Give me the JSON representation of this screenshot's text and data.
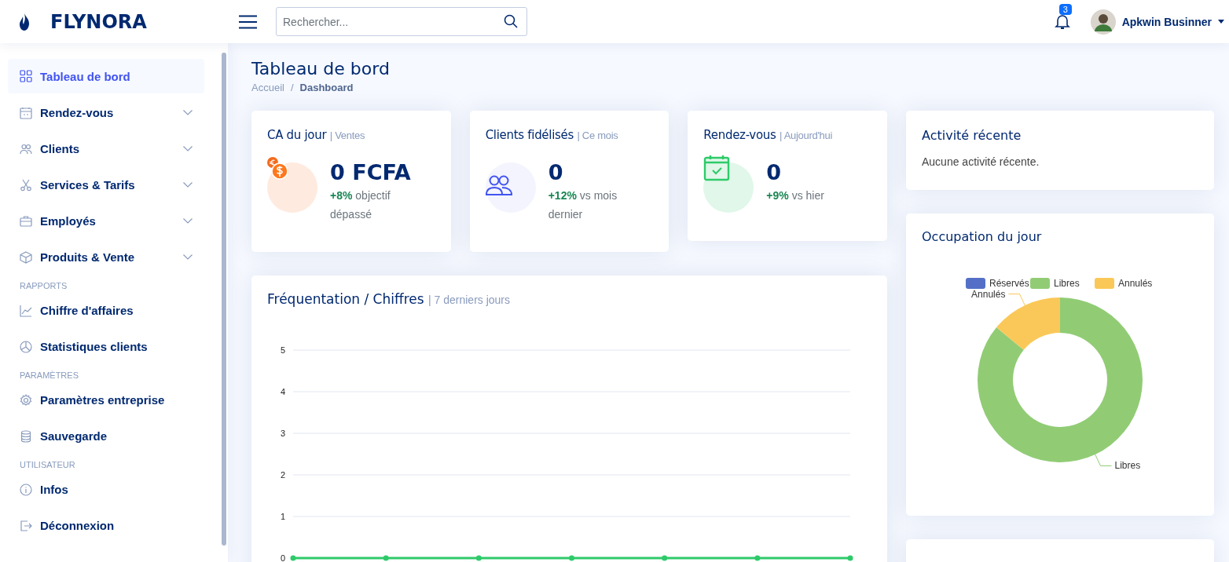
{
  "brand": {
    "name": "FLYNORA"
  },
  "search": {
    "placeholder": "Rechercher..."
  },
  "notifications": {
    "count": "3"
  },
  "user": {
    "name": "Apkwin Businner"
  },
  "sidebar": {
    "sections": [
      {
        "items": [
          {
            "label": "Tableau de bord",
            "kind": "link",
            "selected": true
          },
          {
            "label": "Rendez-vous",
            "kind": "menu",
            "selected": false
          },
          {
            "label": "Clients",
            "kind": "menu",
            "selected": false
          },
          {
            "label": "Services & Tarifs",
            "kind": "menu",
            "selected": false
          },
          {
            "label": "Employés",
            "kind": "menu",
            "selected": false
          },
          {
            "label": "Produits & Vente",
            "kind": "menu",
            "selected": false
          }
        ]
      },
      {
        "heading": "RAPPORTS",
        "items": [
          {
            "label": "Chiffre d'affaires",
            "kind": "link",
            "selected": false
          },
          {
            "label": "Statistiques clients",
            "kind": "link",
            "selected": false
          }
        ]
      },
      {
        "heading": "PARAMÈTRES",
        "items": [
          {
            "label": "Paramètres entreprise",
            "kind": "link",
            "selected": false
          },
          {
            "label": "Sauvegarde",
            "kind": "link",
            "selected": false
          }
        ]
      },
      {
        "heading": "UTILISATEUR",
        "items": [
          {
            "label": "Infos",
            "kind": "link",
            "selected": false
          },
          {
            "label": "Déconnexion",
            "kind": "link",
            "selected": false
          }
        ]
      }
    ]
  },
  "page": {
    "title": "Tableau de bord",
    "breadcrumb": [
      "Accueil",
      "Dashboard"
    ],
    "breadcrumb_separator": "/"
  },
  "stats": [
    {
      "title": "CA du jour",
      "subtitle": "| Ventes",
      "value": "0 FCFA",
      "change": "+8%",
      "note": "objectif dépassé",
      "color": "#ffeadf"
    },
    {
      "title": "Clients fidélisés",
      "subtitle": "| Ce mois",
      "value": "0",
      "change": "+12%",
      "note": "vs mois dernier",
      "color": "#f3f4fd"
    },
    {
      "title": "Rendez-vous",
      "subtitle": "| Aujourd'hui",
      "value": "0",
      "change": "+9%",
      "note": "vs hier",
      "color": "#e0f7e9"
    }
  ],
  "traffic": {
    "title": "Fréquentation / Chiffres",
    "subtitle": "| 7 derniers jours",
    "chart_data": {
      "type": "line",
      "ylim": [
        0,
        5
      ],
      "yticks": [
        0,
        1,
        2,
        3,
        4,
        5
      ],
      "grid": true,
      "series": [
        {
          "color": "#2eca6a",
          "marker": true,
          "values": [
            0,
            0,
            0,
            0,
            0,
            0,
            0
          ]
        }
      ]
    }
  },
  "activity": {
    "title": "Activité récente",
    "empty": "Aucune activité récente."
  },
  "occupation": {
    "title": "Occupation du jour",
    "chart_data": {
      "type": "donut",
      "legend": true,
      "categories": [
        "Réservés",
        "Libres",
        "Annulés"
      ],
      "series": [
        {
          "values": [
            0,
            86,
            14
          ]
        }
      ],
      "colors": [
        "#5470c6",
        "#91cc75",
        "#fac858"
      ]
    }
  }
}
